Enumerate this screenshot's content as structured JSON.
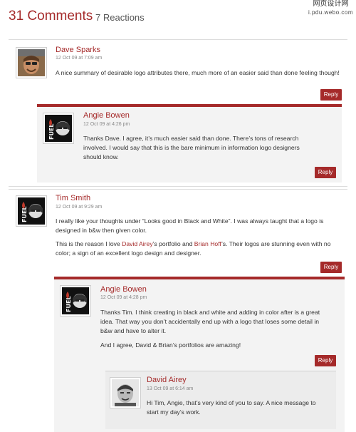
{
  "header": {
    "comments_count": "31 Comments",
    "reactions": "7 Reactions"
  },
  "watermark": {
    "line1": "网页设计网",
    "line2": "i.pdu.webo.com"
  },
  "comments": [
    {
      "author": "Dave Sparks",
      "date": "12 Oct 09 at 7:09 am",
      "paragraphs": [
        "A nice summary of desirable logo attributes there, much more of an easier said than done feeling though!"
      ],
      "reply_label": "Reply",
      "avatar": "user-photo-avatar"
    },
    {
      "author": "Angie Bowen",
      "date": "12 Oct 09 at 4:26 pm",
      "paragraphs": [
        "Thanks Dave. I agree, it’s much easier said than done. There’s tons of research involved. I would say that this is the bare minimum in information logo designers should know."
      ],
      "reply_label": "Reply",
      "avatar": "fuel-logo-avatar"
    },
    {
      "author": "Tim Smith",
      "date": "12 Oct 09 at 9:29 am",
      "paragraphs": [
        "I really like your thoughts under “Looks good in Black and White”. I was always taught that a logo is designed in b&w then given color.",
        "This is the reason I love David Airey’s portfolio and Brian Hoff’s. Their logos are stunning even with no color; a sign of an excellent logo design and designer."
      ],
      "links": [
        "David Airey",
        "Brian Hoff"
      ],
      "reply_label": "Reply",
      "avatar": "fuel-logo-avatar"
    },
    {
      "author": "Angie Bowen",
      "date": "12 Oct 09 at 4:28 pm",
      "paragraphs": [
        "Thanks Tim. I think creating in black and white and adding in color after is a great idea. That way you don’t accidentally end up with a logo that loses some detail in b&w and have to alter it.",
        "And I agree, David & Brian’s portfolios are amazing!"
      ],
      "reply_label": "Reply",
      "avatar": "fuel-logo-avatar"
    },
    {
      "author": "David Airey",
      "date": "13 Oct 09 at 6:14 am",
      "paragraphs": [
        "Hi Tim, Angie, that’s very kind of you to say. A nice message to start my day’s work."
      ],
      "avatar": "user-photo-avatar"
    }
  ]
}
